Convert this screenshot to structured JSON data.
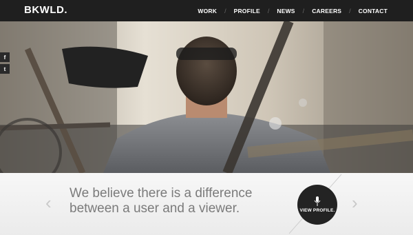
{
  "header": {
    "logo": "BKWLD.",
    "nav": [
      {
        "label": "WORK"
      },
      {
        "label": "PROFILE"
      },
      {
        "label": "NEWS"
      },
      {
        "label": "CAREERS"
      },
      {
        "label": "CONTACT"
      }
    ],
    "nav_separator": "/"
  },
  "social": {
    "facebook": "f",
    "twitter": "t"
  },
  "hero": {
    "image": "photo of a man in a cap riding a bicycle, viewed from behind through a blurred bike frame"
  },
  "callout": {
    "tagline_line1": "We believe there is a difference",
    "tagline_line2": "between a user and a viewer.",
    "button_label": "VIEW PROFILE.",
    "button_icon": "microphone-icon",
    "prev_icon": "chevron-left-icon",
    "next_icon": "chevron-right-icon"
  },
  "colors": {
    "topbar": "#1f1f1f",
    "button": "#232323",
    "tagline": "#7b7b7b"
  }
}
